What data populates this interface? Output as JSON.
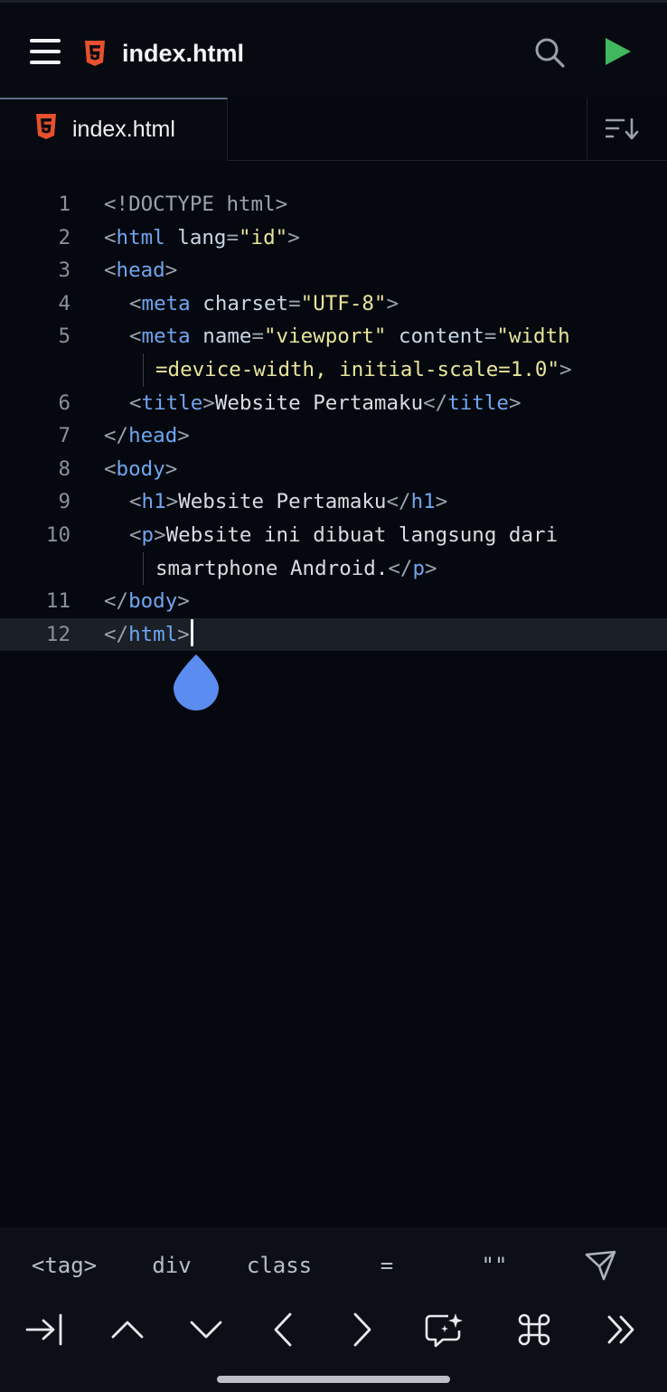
{
  "header": {
    "title": "index.html"
  },
  "tabs": [
    {
      "label": "index.html",
      "active": true
    }
  ],
  "editor": {
    "lines": [
      {
        "n": "1",
        "tokens": [
          [
            "punct",
            "<!DOCTYPE html>"
          ]
        ]
      },
      {
        "n": "2",
        "tokens": [
          [
            "punct",
            "<"
          ],
          [
            "tag",
            "html"
          ],
          [
            "plain",
            " "
          ],
          [
            "attr",
            "lang"
          ],
          [
            "punct",
            "="
          ],
          [
            "str",
            "\"id\""
          ],
          [
            "punct",
            ">"
          ]
        ]
      },
      {
        "n": "3",
        "tokens": [
          [
            "punct",
            "<"
          ],
          [
            "tag",
            "head"
          ],
          [
            "punct",
            ">"
          ]
        ]
      },
      {
        "n": "4",
        "indent": 1,
        "tokens": [
          [
            "punct",
            "<"
          ],
          [
            "tag",
            "meta"
          ],
          [
            "plain",
            " "
          ],
          [
            "attr",
            "charset"
          ],
          [
            "punct",
            "="
          ],
          [
            "str",
            "\"UTF-8\""
          ],
          [
            "punct",
            ">"
          ]
        ]
      },
      {
        "n": "5",
        "indent": 1,
        "tokens": [
          [
            "punct",
            "<"
          ],
          [
            "tag",
            "meta"
          ],
          [
            "plain",
            " "
          ],
          [
            "attr",
            "name"
          ],
          [
            "punct",
            "="
          ],
          [
            "str",
            "\"viewport\""
          ],
          [
            "plain",
            " "
          ],
          [
            "attr",
            "content"
          ],
          [
            "punct",
            "="
          ],
          [
            "str",
            "\"width"
          ]
        ]
      },
      {
        "n": "",
        "indent": 2,
        "tokens": [
          [
            "str",
            "=device-width, initial-scale=1.0\""
          ],
          [
            "punct",
            ">"
          ]
        ]
      },
      {
        "n": "6",
        "indent": 1,
        "tokens": [
          [
            "punct",
            "<"
          ],
          [
            "tag",
            "title"
          ],
          [
            "punct",
            ">"
          ],
          [
            "plain",
            "Website Pertamaku"
          ],
          [
            "punct",
            "</"
          ],
          [
            "tag",
            "title"
          ],
          [
            "punct",
            ">"
          ]
        ]
      },
      {
        "n": "7",
        "tokens": [
          [
            "punct",
            "</"
          ],
          [
            "tag",
            "head"
          ],
          [
            "punct",
            ">"
          ]
        ]
      },
      {
        "n": "8",
        "tokens": [
          [
            "punct",
            "<"
          ],
          [
            "tag",
            "body"
          ],
          [
            "punct",
            ">"
          ]
        ]
      },
      {
        "n": "9",
        "indent": 1,
        "tokens": [
          [
            "punct",
            "<"
          ],
          [
            "tag",
            "h1"
          ],
          [
            "punct",
            ">"
          ],
          [
            "plain",
            "Website Pertamaku"
          ],
          [
            "punct",
            "</"
          ],
          [
            "tag",
            "h1"
          ],
          [
            "punct",
            ">"
          ]
        ]
      },
      {
        "n": "10",
        "indent": 1,
        "tokens": [
          [
            "punct",
            "<"
          ],
          [
            "tag",
            "p"
          ],
          [
            "punct",
            ">"
          ],
          [
            "plain",
            "Website ini dibuat langsung dari"
          ]
        ]
      },
      {
        "n": "",
        "indent": 2,
        "tokens": [
          [
            "plain",
            "smartphone Android."
          ],
          [
            "punct",
            "</"
          ],
          [
            "tag",
            "p"
          ],
          [
            "punct",
            ">"
          ]
        ]
      },
      {
        "n": "11",
        "tokens": [
          [
            "punct",
            "</"
          ],
          [
            "tag",
            "body"
          ],
          [
            "punct",
            ">"
          ]
        ]
      },
      {
        "n": "12",
        "current": true,
        "tokens": [
          [
            "punct",
            "</"
          ],
          [
            "tag",
            "html"
          ],
          [
            "punct",
            ">"
          ]
        ]
      }
    ]
  },
  "keybar": {
    "symbols": [
      "<tag>",
      "div",
      "class",
      "=",
      "\"\""
    ],
    "nav_icons": [
      "tab-icon",
      "arrow-up-icon",
      "arrow-down-icon",
      "arrow-left-icon",
      "arrow-right-icon",
      "ai-chat-icon",
      "command-icon",
      "double-chevron-right-icon"
    ]
  },
  "colors": {
    "tag": "#6fa6f0",
    "string": "#e9e59a",
    "html5": "#e8502e",
    "run": "#3fb860",
    "caret_handle": "#5b8cf0"
  }
}
